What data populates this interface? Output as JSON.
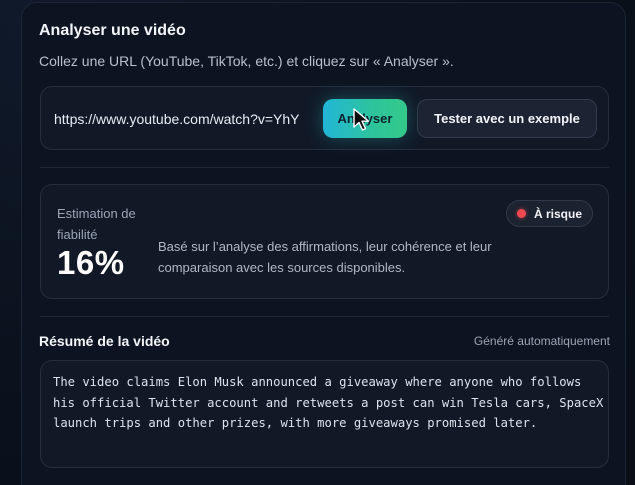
{
  "panel": {
    "title": "Analyser une vidéo",
    "subtitle": "Collez une URL (YouTube, TikTok, etc.) et cliquez sur « Analyser »."
  },
  "url_input": {
    "value": "https://www.youtube.com/watch?v=YhY"
  },
  "buttons": {
    "analyse_label": "Analyser",
    "example_label": "Tester avec un exemple"
  },
  "reliability": {
    "label": "Estimation de fiabilité",
    "score": "16%",
    "badge": "À risque",
    "description": "Basé sur l’analyse des affirmations, leur cohérence et leur comparaison avec les sources disponibles."
  },
  "summary": {
    "title": "Résumé de la vidéo",
    "meta": "Généré automatiquement",
    "text": "The video claims Elon Musk announced a giveaway where anyone who follows his official Twitter account and retweets a post can win Tesla cars, SpaceX launch trips and other prizes, with more giveaways promised later."
  },
  "colors": {
    "accent_start": "#22b6d8",
    "accent_end": "#33c98a",
    "risk": "#ef4a4f",
    "background": "#0d1421"
  },
  "icons": {
    "cursor": "mouse-pointer-icon",
    "badge_status": "risk-dot-icon"
  }
}
